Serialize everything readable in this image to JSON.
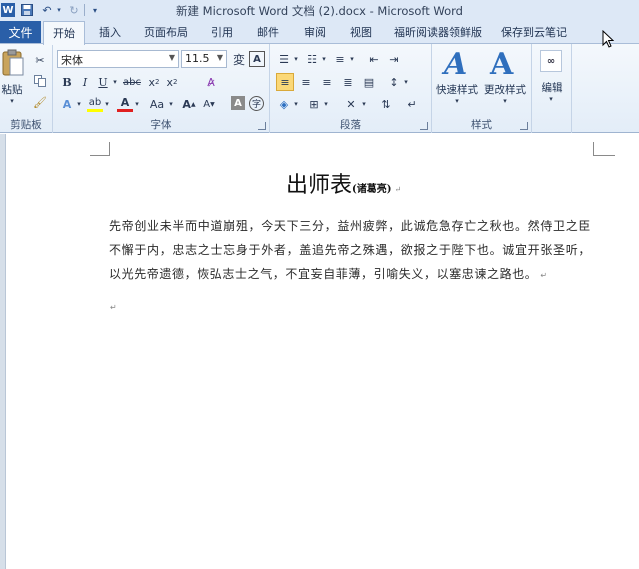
{
  "window": {
    "title": "新建 Microsoft Word 文档 (2).docx  -  Microsoft Word"
  },
  "qat": {
    "save_icon": "save-icon",
    "undo_icon": "undo-icon",
    "redo_icon": "redo-icon",
    "customize_icon": "customize-icon"
  },
  "tabs": {
    "file": "文件",
    "items": [
      "开始",
      "插入",
      "页面布局",
      "引用",
      "邮件",
      "审阅",
      "视图",
      "福昕阅读器领鲜版",
      "保存到云笔记"
    ],
    "active": "开始"
  },
  "ribbon": {
    "clipboard": {
      "label": "剪贴板",
      "paste": "粘贴"
    },
    "font": {
      "label": "字体",
      "font_name": "宋体",
      "font_size": "11.5"
    },
    "paragraph": {
      "label": "段落"
    },
    "styles": {
      "label": "样式",
      "quick_styles": "快速样式",
      "change_styles": "更改样式"
    },
    "editing": {
      "label": "编辑"
    }
  },
  "document": {
    "title": "出师表",
    "author": "(诸葛亮)",
    "body": "先帝创业未半而中道崩殂，今天下三分，益州疲弊，此诚危急存亡之秋也。然侍卫之臣不懈于内，忠志之士忘身于外者，盖追先帝之殊遇，欲报之于陛下也。诚宜开张圣听，以光先帝遗德，恢弘志士之气，不宜妄自菲薄，引喻失义，以塞忠谏之路也。",
    "paragraph_mark": "↵"
  },
  "colors": {
    "file_tab": "#2a5fa8",
    "ribbon_bg": "#e3edf8",
    "title_bar": "#dde8f6"
  }
}
